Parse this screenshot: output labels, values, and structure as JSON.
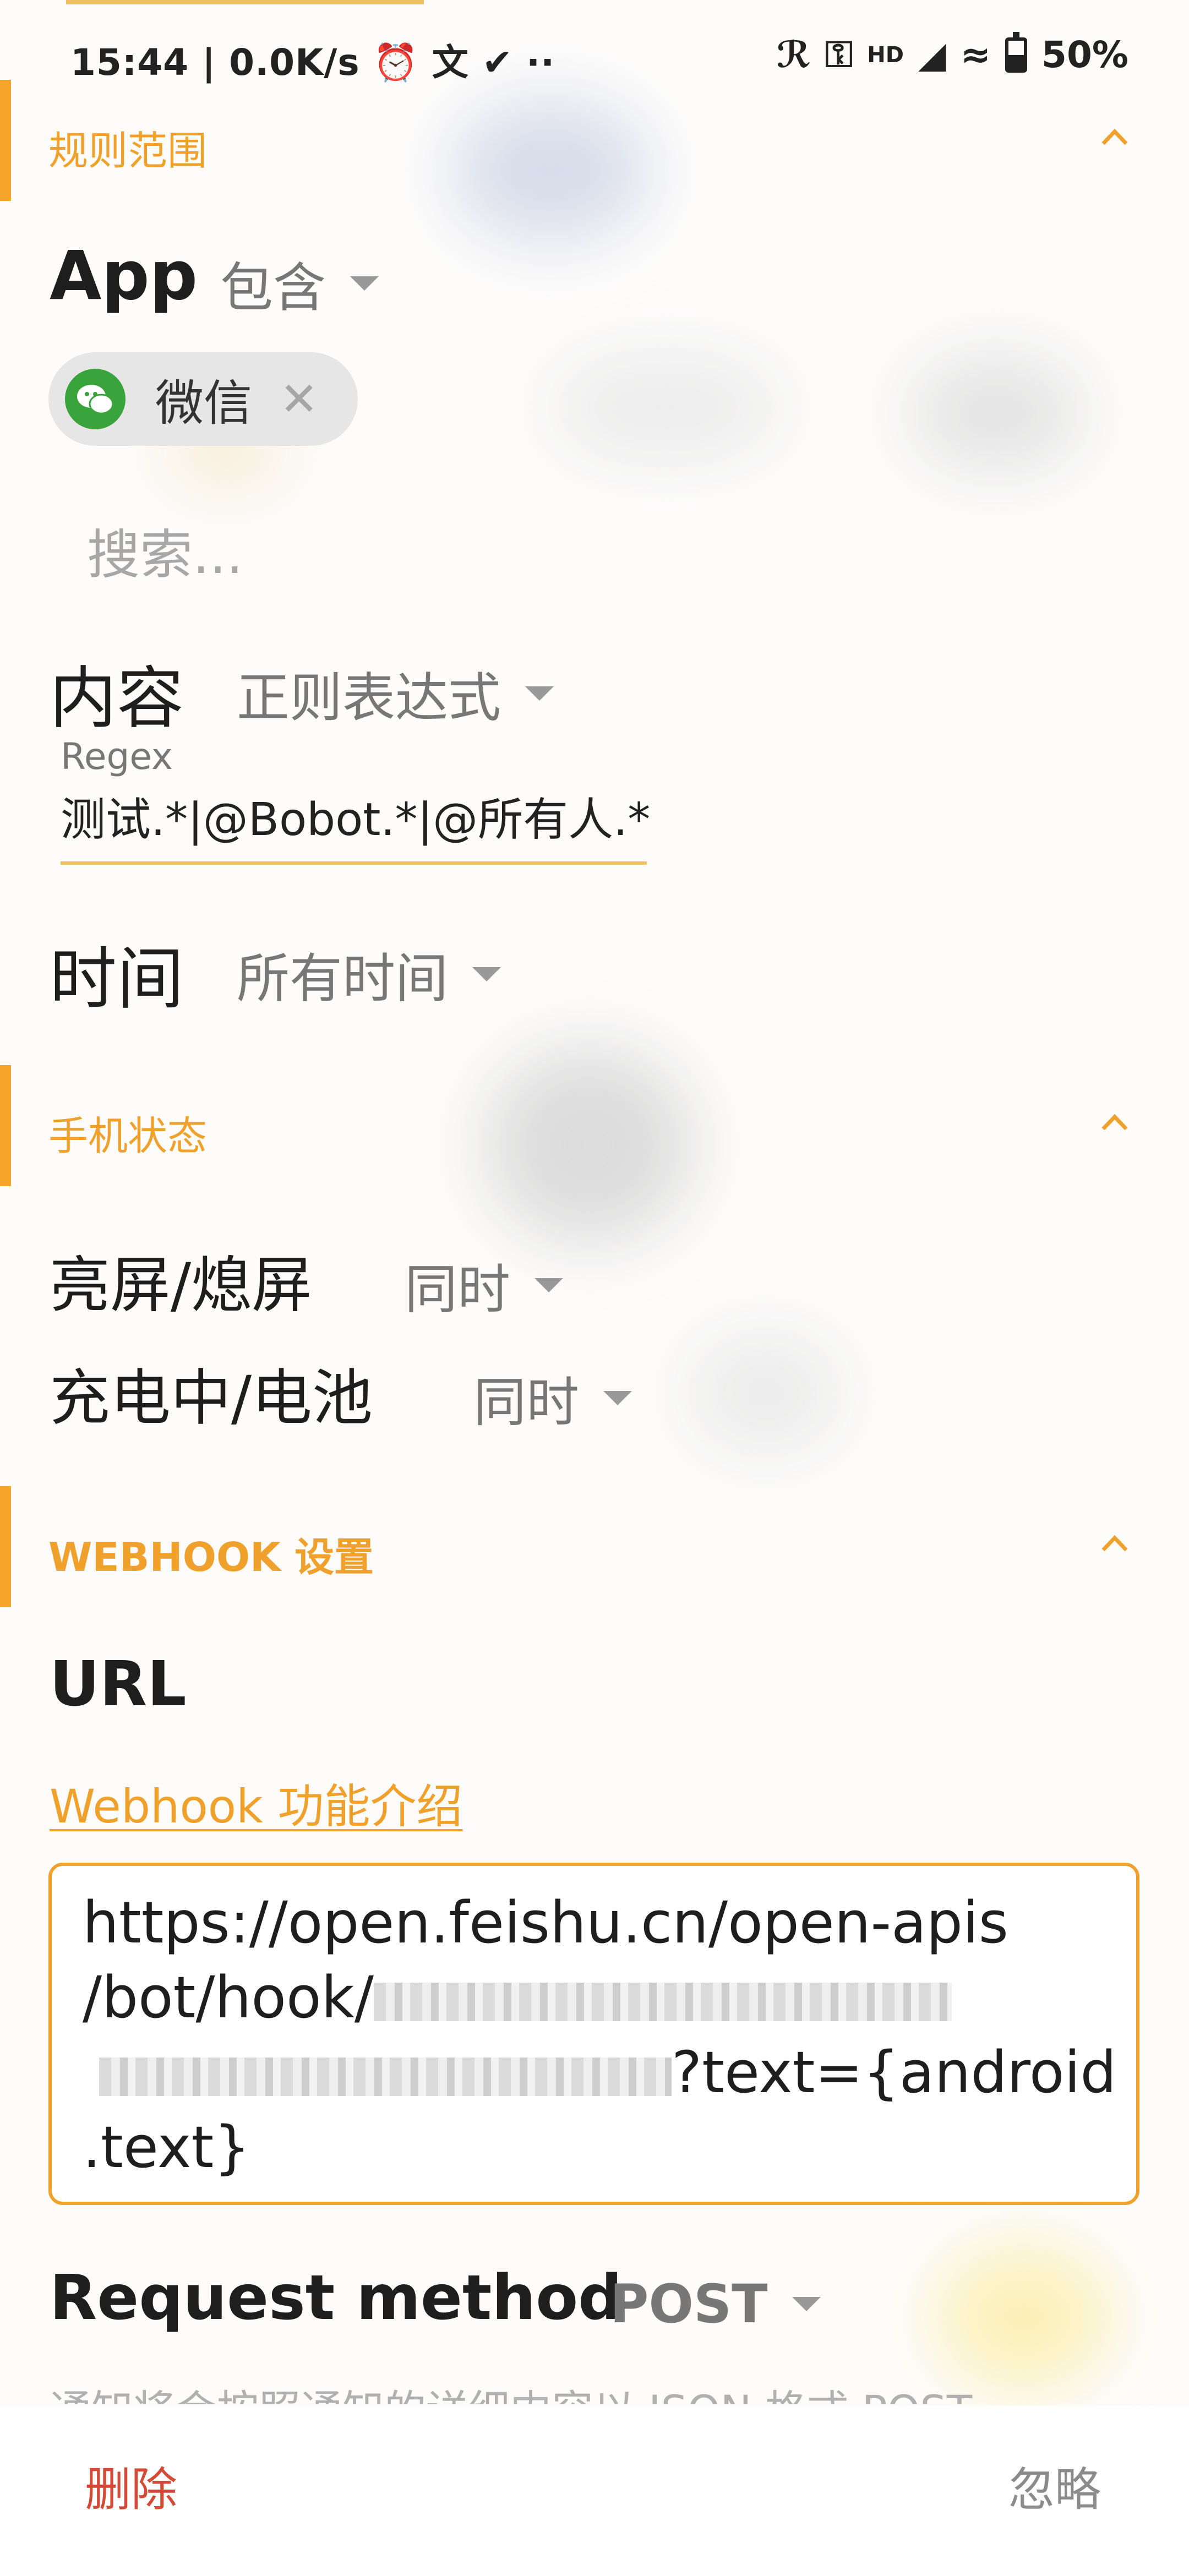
{
  "status_bar": {
    "time_speed": "15:44 | 0.0K/s",
    "hd": "HD",
    "battery": "50%",
    "battery_level": 0.5
  },
  "rule_scope": {
    "title": "规则范围",
    "app_label": "App",
    "app_mode": "包含",
    "app_chip": "微信",
    "search_placeholder": "搜索...",
    "content_label": "内容",
    "content_mode": "正则表达式",
    "regex_label": "Regex",
    "regex_value": "测试.*|@Bobot.*|@所有人.*",
    "time_label": "时间",
    "time_mode": "所有时间"
  },
  "phone_state": {
    "title": "手机状态",
    "screen_label": "亮屏/熄屏",
    "screen_mode": "同时",
    "charging_label": "充电中/电池",
    "charging_mode": "同时"
  },
  "webhook": {
    "title": "WEBHOOK 设置",
    "url_label": "URL",
    "intro_link": "Webhook 功能介绍",
    "url_line1": "https://open.feishu.cn/open-apis",
    "url_line2": "/bot/hook/",
    "url_line3_suffix": "?text={android",
    "url_line4": ".text}",
    "method_label": "Request method",
    "method_value": "POST",
    "description": "通知将会按照通知的详细内容以 JSON 格式 POST"
  },
  "actions": {
    "delete": "删除",
    "ignore": "忽略"
  }
}
